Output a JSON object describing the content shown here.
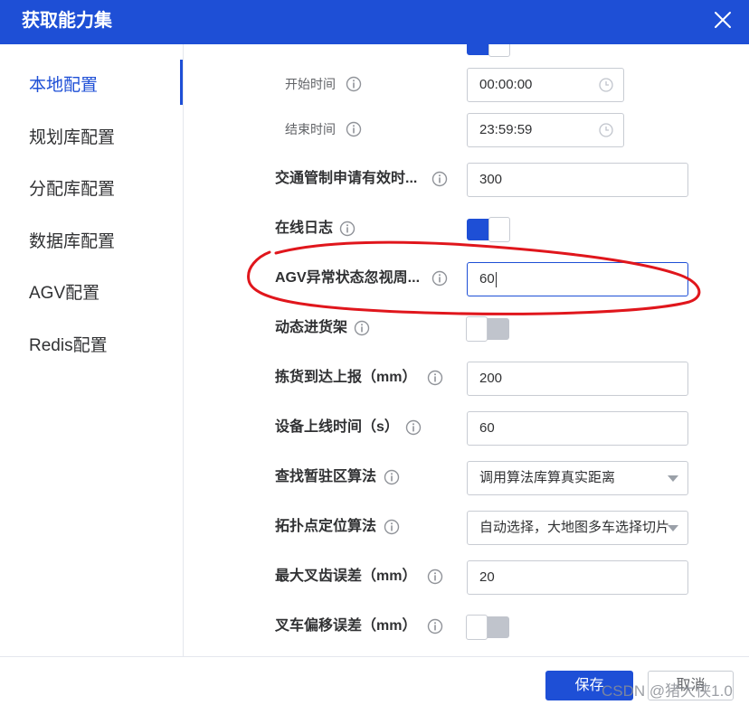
{
  "dialog": {
    "title": "获取能力集"
  },
  "sidebar": {
    "items": [
      {
        "label": "本地配置",
        "active": true
      },
      {
        "label": "规划库配置"
      },
      {
        "label": "分配库配置"
      },
      {
        "label": "数据库配置"
      },
      {
        "label": "AGV配置"
      },
      {
        "label": "Redis配置"
      }
    ]
  },
  "form": {
    "start_time": {
      "label": "开始时间",
      "value": "00:00:00"
    },
    "end_time": {
      "label": "结束时间",
      "value": "23:59:59"
    },
    "traffic_valid": {
      "label": "交通管制申请有效时...",
      "value": "300"
    },
    "online_log": {
      "label": "在线日志",
      "state": "on"
    },
    "agv_ignore": {
      "label": "AGV异常状态忽视周...",
      "value": "60"
    },
    "dynamic_shelf": {
      "label": "动态进货架",
      "state": "off"
    },
    "pick_report": {
      "label": "拣货到达上报（mm）",
      "value": "200"
    },
    "device_online": {
      "label": "设备上线时间（s）",
      "value": "60"
    },
    "staging_algo": {
      "label": "查找暂驻区算法",
      "value": "调用算法库算真实距离"
    },
    "topo_algo": {
      "label": "拓扑点定位算法",
      "value": "自动选择，大地图多车选择切片"
    },
    "fork_tooth": {
      "label": "最大叉齿误差（mm）",
      "value": "20"
    },
    "fork_offset": {
      "label": "叉车偏移误差（mm）",
      "state": "off"
    }
  },
  "footer": {
    "save_label": "保存",
    "cancel_label": "取消"
  },
  "watermark": "CSDN @猪大侠1.0",
  "colors": {
    "primary": "#1e4fd6",
    "annotation": "#e0161c"
  }
}
